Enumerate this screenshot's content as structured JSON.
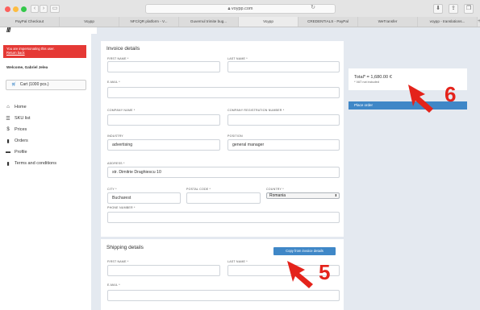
{
  "browser": {
    "url": "voypp.com",
    "tabs": [
      "PayPal Checkout",
      "Voypp",
      "NFC/QR platform - V...",
      "Guvernul trimite bug...",
      "Voypp",
      "CREDENTIALS - PayPal",
      "WeTransfer",
      "voypp - translations..."
    ],
    "new_tab": "+"
  },
  "sidebar": {
    "impersonation_text": "You are impersonating this user.",
    "return_link": "Return back",
    "welcome": "Welcome, Gabriel Jelea",
    "cart_label": "Cart (1000 pcs.)",
    "nav": [
      {
        "label": "Home",
        "icon": "home-icon"
      },
      {
        "label": "SKU list",
        "icon": "list-icon"
      },
      {
        "label": "Prices",
        "icon": "dollar-icon"
      },
      {
        "label": "Orders",
        "icon": "document-icon"
      },
      {
        "label": "Profile",
        "icon": "id-card-icon"
      },
      {
        "label": "Terms and conditions",
        "icon": "book-icon"
      }
    ]
  },
  "invoice": {
    "title": "Invoice details",
    "first_name_label": "FIRST NAME *",
    "first_name_value": "",
    "last_name_label": "LAST NAME *",
    "last_name_value": "",
    "email_label": "E-MAIL *",
    "email_value": "",
    "company_name_label": "COMPANY NAME *",
    "company_name_value": "",
    "company_reg_label": "COMPANY REGISTRATION NUMBER *",
    "company_reg_value": "",
    "industry_label": "INDUSTRY",
    "industry_value": "advertising",
    "position_label": "POSITION",
    "position_value": "general manager",
    "address_label": "ADDRESS *",
    "address_value": "str. Dimitrie Draghiescu 10",
    "city_label": "CITY *",
    "city_value": "Bucharest",
    "postal_label": "POSTAL CODE *",
    "postal_value": "",
    "country_label": "COUNTRY *",
    "country_value": "Romania",
    "phone_label": "PHONE NUMBER *",
    "phone_value": ""
  },
  "shipping": {
    "title": "Shipping details",
    "copy_button": "Copy from invoice details",
    "first_name_label": "FIRST NAME *",
    "last_name_label": "LAST NAME *",
    "email_label": "E-MAIL *"
  },
  "summary": {
    "total": "Total* = 1,680.00 €",
    "vat_note": "* VAT not included",
    "place_order": "Place order"
  },
  "annotations": {
    "step_6": "6",
    "step_5": "5",
    "color": "#e4231b"
  }
}
